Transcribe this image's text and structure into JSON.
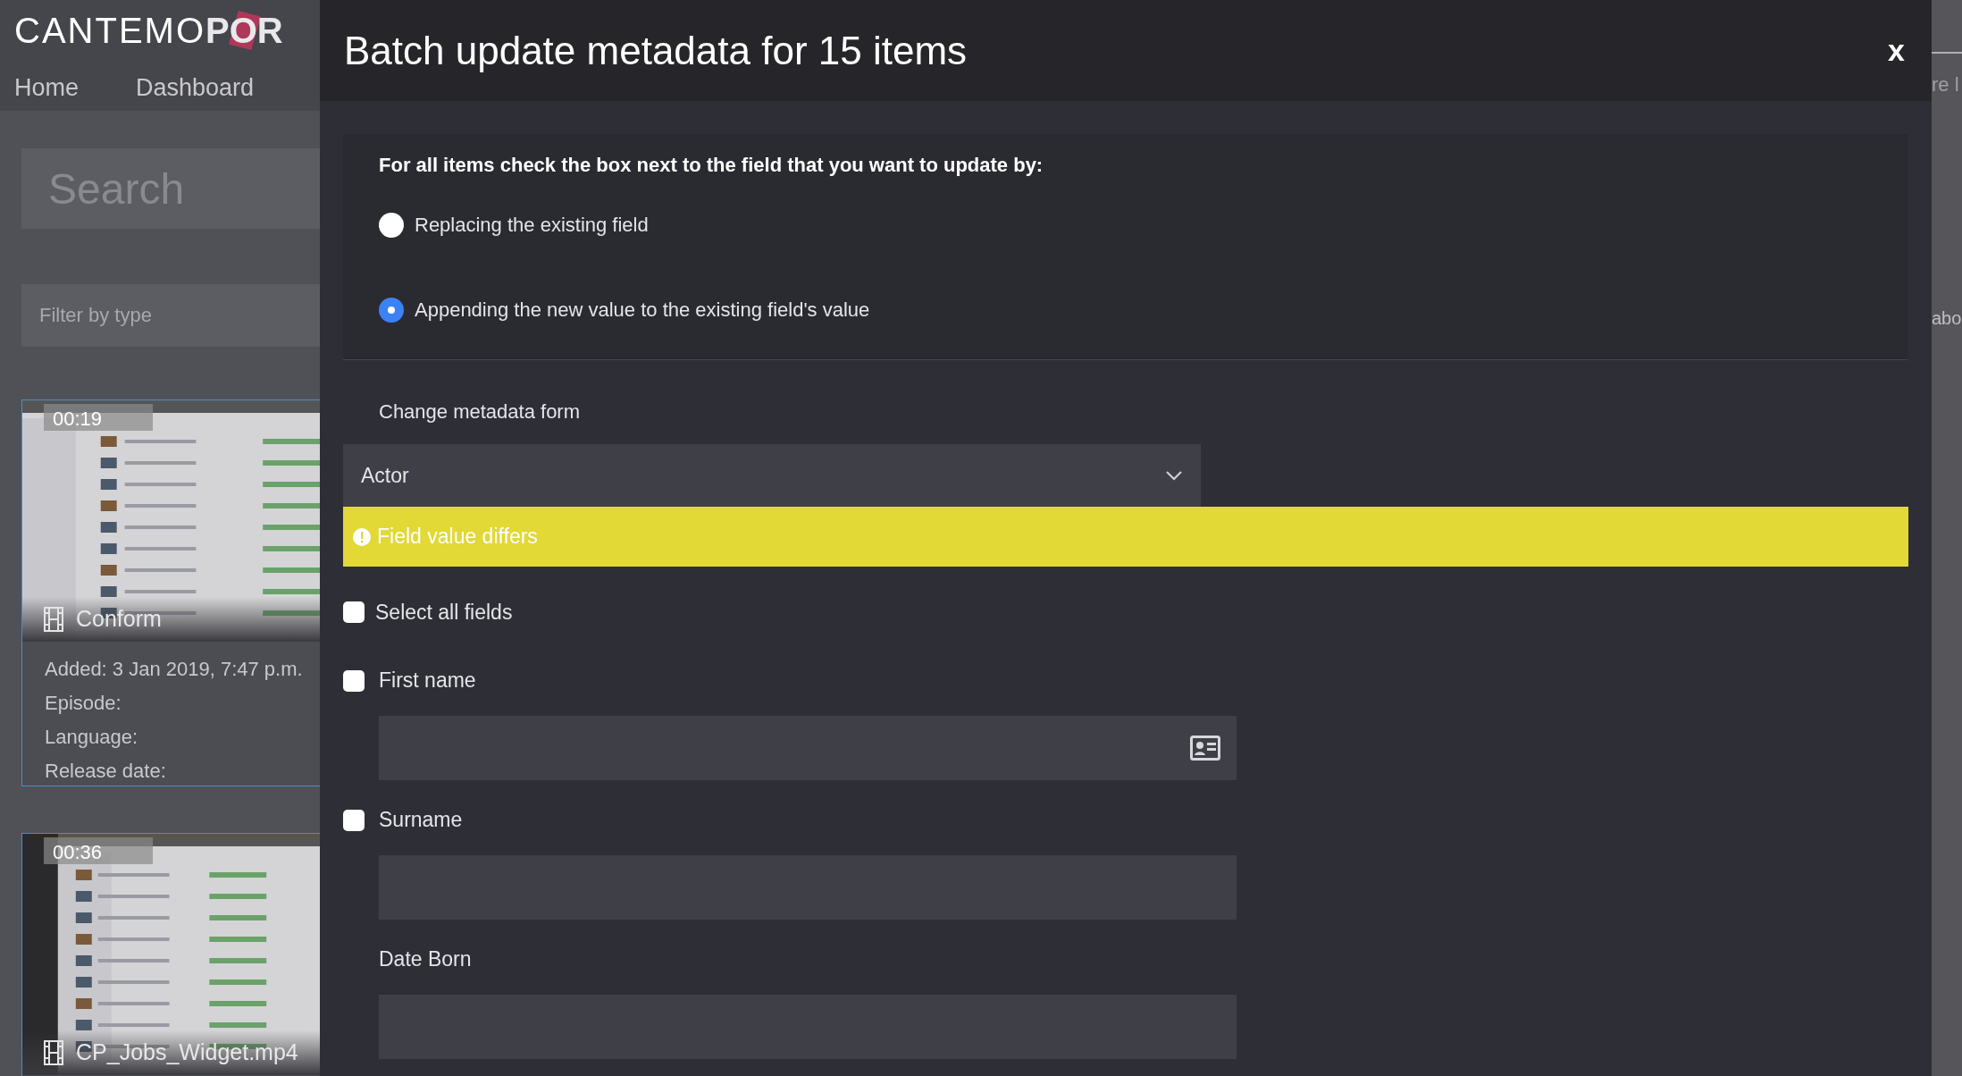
{
  "app": {
    "logo_light": "CANTEMO",
    "logo_bold": "POR",
    "nav": [
      "Home",
      "Dashboard"
    ],
    "search": {
      "placeholder": "Search"
    },
    "filter": {
      "placeholder": "Filter by type"
    },
    "items": [
      {
        "duration": "00:19",
        "title": "Conform",
        "details": [
          "Added: 3 Jan 2019, 7:47 p.m.",
          "Episode:",
          "Language:",
          "Release date:"
        ]
      },
      {
        "duration": "00:36",
        "title": "CP_Jobs_Widget.mp4"
      }
    ],
    "right_edge": [
      "re l",
      "abo"
    ]
  },
  "modal": {
    "title": "Batch update metadata for 15 items",
    "close": "x",
    "instruction": "For all items check the box next to the field that you want to update by:",
    "modes": [
      {
        "label": "Replacing the existing field",
        "selected": false
      },
      {
        "label": "Appending the new value to the existing field's value",
        "selected": true
      }
    ],
    "form_label": "Change metadata form",
    "form_value": "Actor",
    "notice": "Field value differs",
    "select_all": {
      "label": "Select all fields",
      "checked": false
    },
    "fields": [
      {
        "label": "First name",
        "kind": "checkbox",
        "checked": false,
        "picker": true
      },
      {
        "label": "Surname",
        "kind": "checkbox",
        "checked": false,
        "picker": false
      },
      {
        "label": "Date Born",
        "kind": "plain",
        "picker": false
      }
    ]
  }
}
